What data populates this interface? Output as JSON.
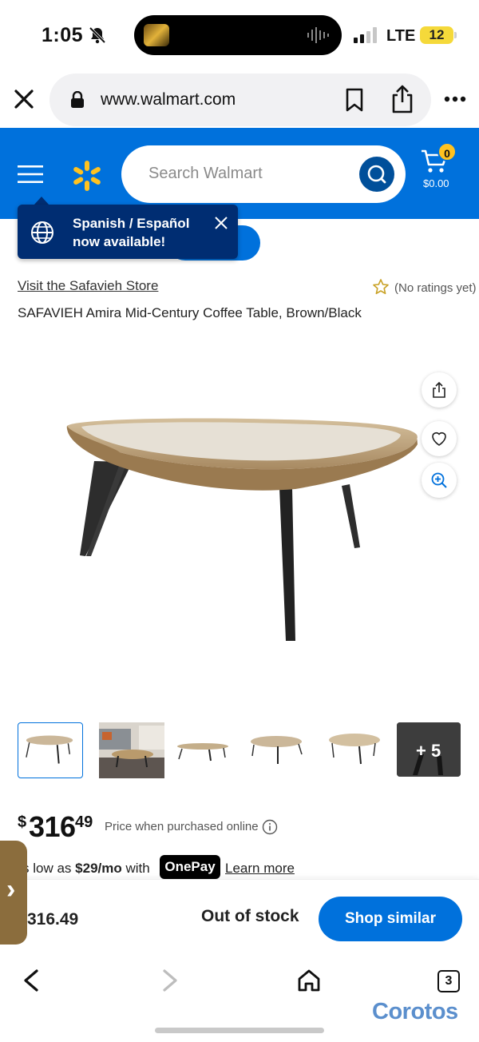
{
  "status_bar": {
    "time": "1:05",
    "network": "LTE",
    "battery": "12",
    "icons": [
      "bell-slash-icon",
      "signal-icon",
      "battery-icon"
    ]
  },
  "browser": {
    "url": "www.walmart.com",
    "tab_count": "3",
    "icons": [
      "close-icon",
      "lock-icon",
      "bookmark-icon",
      "share-icon",
      "more-icon",
      "back-icon",
      "forward-icon",
      "home-icon"
    ]
  },
  "header": {
    "search_placeholder": "Search Walmart",
    "cart_count": "0",
    "cart_total": "$0.00",
    "brand_color": "#0071dc"
  },
  "tooltip": {
    "text": "Spanish / Español now available!"
  },
  "product": {
    "store_link": "Visit the Safavieh Store",
    "ratings": "(No ratings yet)",
    "title": "SAFAVIEH Amira Mid-Century Coffee Table, Brown/Black",
    "more_images": "+ 5",
    "price_currency": "$",
    "price_dollars": "316",
    "price_cents": "49",
    "price_note": "Price when purchased online",
    "onepay_prefix": "s low as",
    "onepay_amount": "$29/mo",
    "onepay_with": "with",
    "onepay_brand": "OnePay",
    "learn_more": "Learn more"
  },
  "bottom_bar": {
    "price": "316.49",
    "stock_status": "Out of stock",
    "cta": "Shop similar"
  },
  "watermark": "Corotos"
}
